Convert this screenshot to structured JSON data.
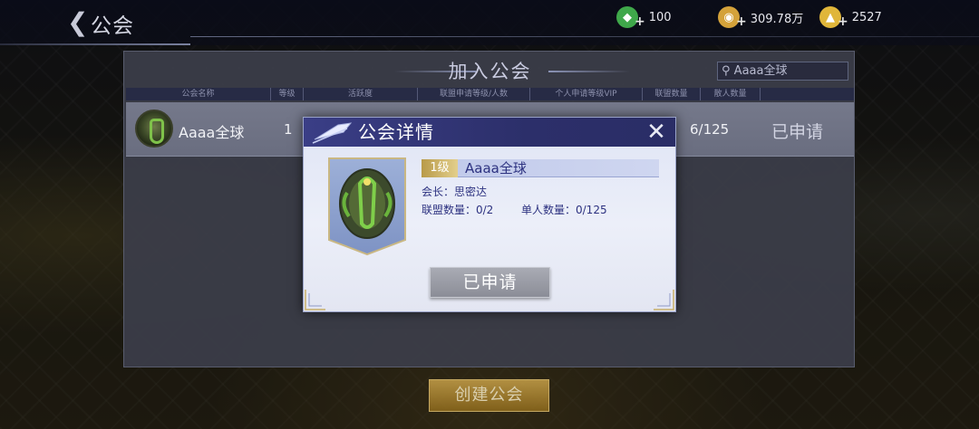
{
  "topbar": {
    "back_icon": "chevron-left-icon",
    "title": "公会",
    "currencies": [
      {
        "icon": "green-gem-icon",
        "value": "100",
        "color": "#3fa84a"
      },
      {
        "icon": "gold-coin-icon",
        "value": "309.78万",
        "color": "#d4a23a"
      },
      {
        "icon": "gold-ingot-icon",
        "value": "2527",
        "color": "#e0b63a"
      }
    ]
  },
  "list_panel": {
    "title": "加入公会",
    "search_placeholder": "Aaaa全球",
    "columns": [
      "公会名称",
      "等级",
      "活跃度",
      "联盟申请等级/人数",
      "个人申请等级VIP",
      "联盟数量",
      "散人数量"
    ],
    "rows": [
      {
        "name": "Aaaa全球",
        "level": "1",
        "members": "6/125",
        "status": "已申请"
      }
    ],
    "create_button": "创建公会"
  },
  "dialog": {
    "title": "公会详情",
    "level_tag": "1级",
    "guild_name": "Aaaa全球",
    "leader": "会长：思密达",
    "alliance_count": "联盟数量：0/2",
    "individual_count": "单人数量：0/125",
    "applied_button": "已申请"
  }
}
